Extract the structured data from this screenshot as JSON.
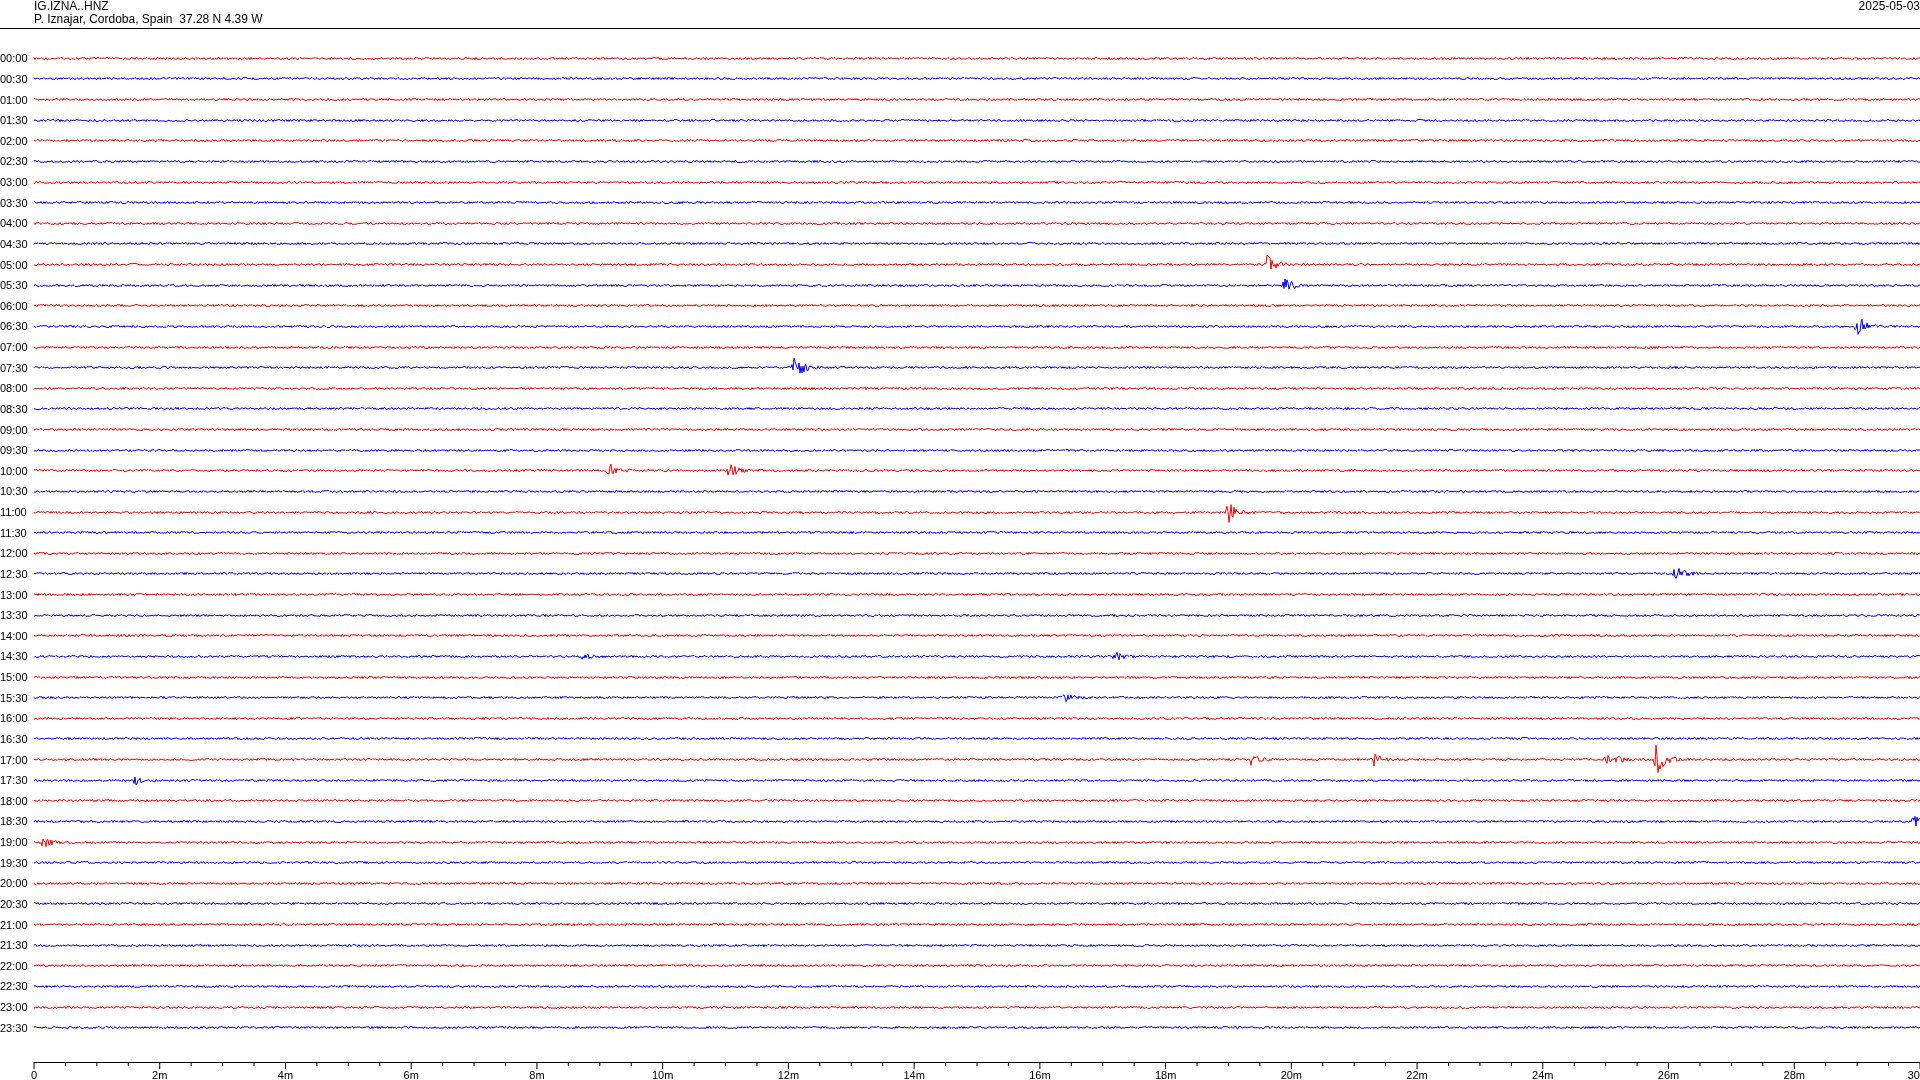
{
  "header": {
    "station": "IG.IZNA..HNZ",
    "location": "P. Iznajar, Cordoba, Spain  37.28 N 4.39 W",
    "date": "2025-05-03"
  },
  "traces": [
    {
      "label": "00:00",
      "color": "#ff0000"
    },
    {
      "label": "00:30",
      "color": "#0000ff"
    },
    {
      "label": "01:00",
      "color": "#ff0000"
    },
    {
      "label": "01:30",
      "color": "#0000ff"
    },
    {
      "label": "02:00",
      "color": "#ff0000"
    },
    {
      "label": "02:30",
      "color": "#0000ff"
    },
    {
      "label": "03:00",
      "color": "#ff0000"
    },
    {
      "label": "03:30",
      "color": "#0000ff"
    },
    {
      "label": "04:00",
      "color": "#ff0000"
    },
    {
      "label": "04:30",
      "color": "#0000ff"
    },
    {
      "label": "05:00",
      "color": "#ff0000"
    },
    {
      "label": "05:30",
      "color": "#0000ff"
    },
    {
      "label": "06:00",
      "color": "#ff0000"
    },
    {
      "label": "06:30",
      "color": "#0000ff"
    },
    {
      "label": "07:00",
      "color": "#ff0000"
    },
    {
      "label": "07:30",
      "color": "#0000ff"
    },
    {
      "label": "08:00",
      "color": "#ff0000"
    },
    {
      "label": "08:30",
      "color": "#0000ff"
    },
    {
      "label": "09:00",
      "color": "#ff0000"
    },
    {
      "label": "09:30",
      "color": "#0000ff"
    },
    {
      "label": "10:00",
      "color": "#ff0000"
    },
    {
      "label": "10:30",
      "color": "#0000ff"
    },
    {
      "label": "11:00",
      "color": "#ff0000"
    },
    {
      "label": "11:30",
      "color": "#0000ff"
    },
    {
      "label": "12:00",
      "color": "#ff0000"
    },
    {
      "label": "12:30",
      "color": "#0000ff"
    },
    {
      "label": "13:00",
      "color": "#ff0000"
    },
    {
      "label": "13:30",
      "color": "#0000ff"
    },
    {
      "label": "14:00",
      "color": "#ff0000"
    },
    {
      "label": "14:30",
      "color": "#0000ff"
    },
    {
      "label": "15:00",
      "color": "#ff0000"
    },
    {
      "label": "15:30",
      "color": "#0000ff"
    },
    {
      "label": "16:00",
      "color": "#ff0000"
    },
    {
      "label": "16:30",
      "color": "#0000ff"
    },
    {
      "label": "17:00",
      "color": "#ff0000"
    },
    {
      "label": "17:30",
      "color": "#0000ff"
    },
    {
      "label": "18:00",
      "color": "#ff0000"
    },
    {
      "label": "18:30",
      "color": "#0000ff"
    },
    {
      "label": "19:00",
      "color": "#ff0000"
    },
    {
      "label": "19:30",
      "color": "#0000ff"
    },
    {
      "label": "20:00",
      "color": "#ff0000"
    },
    {
      "label": "20:30",
      "color": "#0000ff"
    },
    {
      "label": "21:00",
      "color": "#ff0000"
    },
    {
      "label": "21:30",
      "color": "#0000ff"
    },
    {
      "label": "22:00",
      "color": "#ff0000"
    },
    {
      "label": "22:30",
      "color": "#0000ff"
    },
    {
      "label": "23:00",
      "color": "#ff0000"
    },
    {
      "label": "23:30",
      "color": "#0000ff"
    }
  ],
  "x_axis": {
    "tick_labels": [
      "0",
      "2m",
      "4m",
      "6m",
      "8m",
      "10m",
      "12m",
      "14m",
      "16m",
      "18m",
      "20m",
      "22m",
      "24m",
      "26m",
      "28m",
      "30"
    ]
  }
}
